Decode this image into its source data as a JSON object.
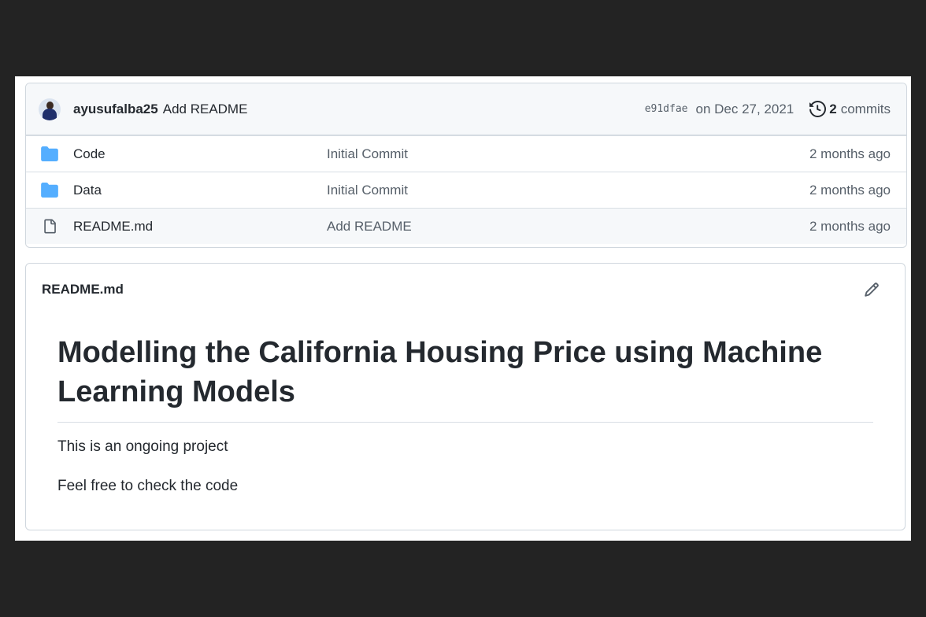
{
  "commit": {
    "author": "ayusufalba25",
    "message": "Add README",
    "sha": "e91dfae",
    "date": "on Dec 27, 2021",
    "count": "2",
    "count_label": "commits"
  },
  "files": [
    {
      "name": "Code",
      "type": "folder",
      "message": "Initial Commit",
      "age": "2 months ago"
    },
    {
      "name": "Data",
      "type": "folder",
      "message": "Initial Commit",
      "age": "2 months ago"
    },
    {
      "name": "README.md",
      "type": "file",
      "message": "Add README",
      "age": "2 months ago"
    }
  ],
  "readme": {
    "filename": "README.md",
    "heading": "Modelling the California Housing Price using Machine Learning Models",
    "paragraphs": [
      "This is an ongoing project",
      "Feel free to check the code"
    ]
  },
  "icons": {
    "folder": "folder-icon",
    "file": "file-icon",
    "history": "history-icon",
    "edit": "pencil-icon"
  },
  "colors": {
    "folder": "#54aeff",
    "background": "#232323",
    "border": "#d0d7de"
  }
}
